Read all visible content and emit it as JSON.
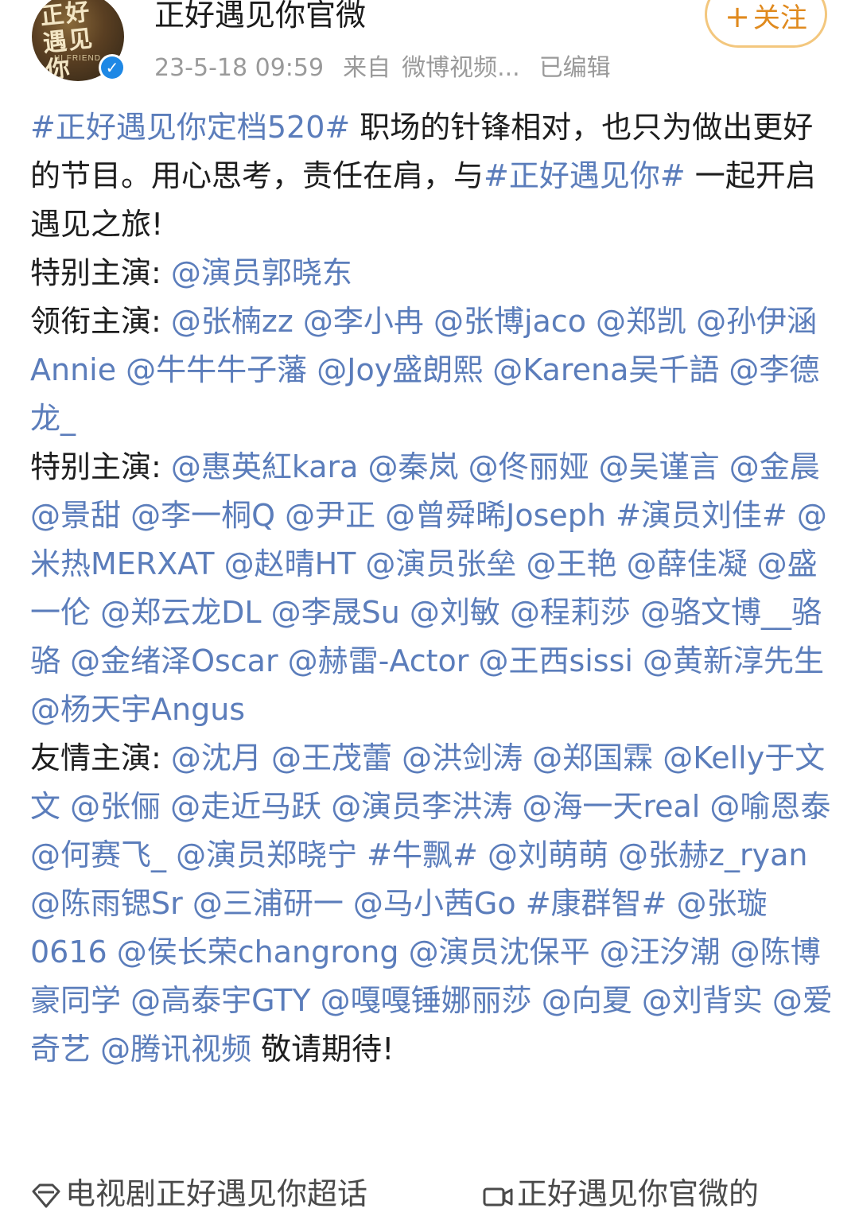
{
  "header": {
    "account_name": "正好遇见你官微",
    "timestamp": "23-5-18 09:59",
    "source_label": "来自",
    "source": "微博视频...",
    "edited": "已编辑",
    "follow_label": "关注",
    "avatar_text": "正好遇见你",
    "avatar_subtext": "HI FRIEND",
    "verified_icon": "verified-check-icon"
  },
  "post": {
    "p1": {
      "tag1": "#正好遇见你定档520#",
      "text1": " 职场的针锋相对，也只为做出更好的节目。用心思考，责任在肩，与",
      "tag2": "#正好遇见你#",
      "text2": " 一起开启遇见之旅!"
    },
    "special_star_label": "特别主演:",
    "special_star": "@演员郭晓东",
    "leading_label": "领衔主演:",
    "leading": "@张楠zz @李小冉 @张博jaco @郑凯 @孙伊涵Annie @牛牛牛子藩 @Joy盛朗熙 @Karena吴千語 @李德龙_",
    "special2_label": "特别主演:",
    "special2_a": "@惠英紅kara @秦岚 @佟丽娅 @吴谨言 @金晨 @景甜 @李一桐Q @尹正 @曾舜晞Joseph ",
    "special2_tag": "#演员刘佳#",
    "special2_b": " @米热MERXAT @赵晴HT @演员张垒 @王艳 @薛佳凝 @盛一伦 @郑云龙DL @李晟Su @刘敏 @程莉莎 @骆文博__骆骆 @金绪泽Oscar @赫雷-Actor @王西sissi @黄新淳先生 @杨天宇Angus",
    "friend_label": "友情主演:",
    "friend_a": "@沈月 @王茂蕾 @洪剑涛 @郑国霖 @Kelly于文文 @张俪 @走近马跃 @演员李洪涛 @海一天real @喻恩泰 @何赛飞_ @演员郑晓宁 ",
    "friend_tag1": "#牛飘#",
    "friend_b": " @刘萌萌 @张赫z_ryan @陈雨锶Sr @三浦研一 @马小茜Go ",
    "friend_tag2": "#康群智#",
    "friend_c": " @张璇0616 @侯长荣changrong @演员沈保平 @汪汐潮 @陈博豪同学 @高泰宇GTY @嘎嘎锤娜丽莎 @向夏 @刘背实 @爱奇艺 @腾讯视频",
    "closing": " 敬请期待!"
  },
  "footer": {
    "topic": "电视剧正好遇见你超话",
    "source": "正好遇见你官微的"
  },
  "colors": {
    "link": "#5b7dbb",
    "follow_border": "#f3c77e",
    "follow_text": "#e08a1e",
    "verified": "#1e88e5",
    "meta": "#9a9a9a"
  }
}
